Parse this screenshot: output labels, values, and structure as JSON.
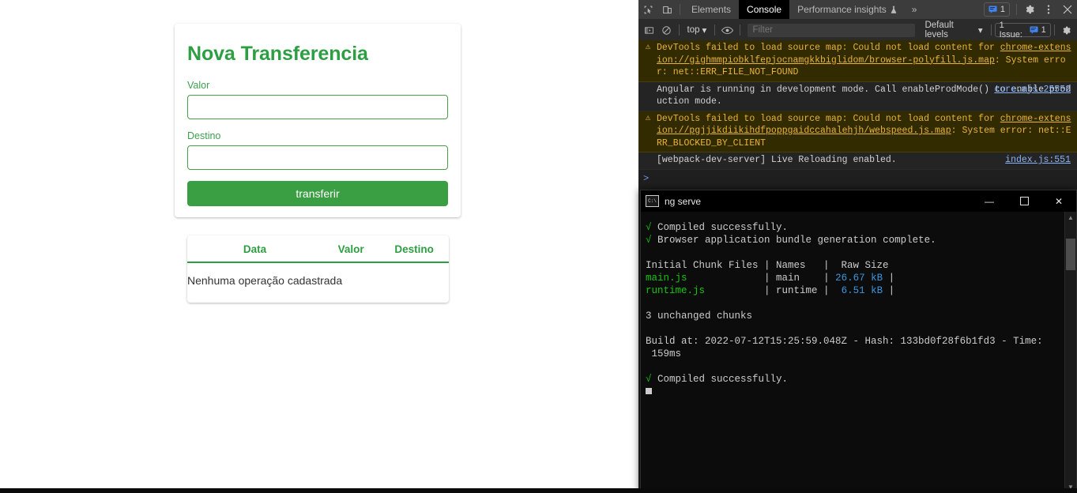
{
  "app": {
    "form": {
      "title": "Nova Transferencia",
      "fields": [
        {
          "label": "Valor",
          "value": "",
          "placeholder": ""
        },
        {
          "label": "Destino",
          "value": "",
          "placeholder": ""
        }
      ],
      "submit_label": "transferir",
      "accent_color": "#2e9e43",
      "button_color": "#3a9e43"
    },
    "table": {
      "headers": [
        "Data",
        "Valor",
        "Destino"
      ],
      "empty_message": "Nenhuma operação cadastrada"
    }
  },
  "devtools": {
    "toolbar": {
      "inspect_icon": "inspect-cursor-icon",
      "device_icon": "device-toolbar-icon",
      "tabs": [
        {
          "label": "Elements",
          "active": false
        },
        {
          "label": "Console",
          "active": true
        },
        {
          "label": "Performance insights",
          "active": false,
          "icon": "flask-icon"
        }
      ],
      "more_tabs": "»",
      "message_badge_count": "1",
      "settings_icon": "gear-icon",
      "menu_icon": "kebab-menu-icon",
      "close_icon": "close-icon"
    },
    "filterbar": {
      "sidebar_icon": "console-sidebar-icon",
      "clear_icon": "clear-console-icon",
      "context": "top",
      "eye_icon": "eye-icon",
      "filter_placeholder": "Filter",
      "filter_value": "",
      "levels": "Default levels",
      "issues_label": "1 Issue:",
      "issues_count": "1",
      "settings_icon": "gear-icon"
    },
    "messages": [
      {
        "level": "warn",
        "icon": "warning-icon",
        "text": "DevTools failed to load source map: Could not load content for chrome-extension://gighmmpiobklfepjocnamgkkbiglidom/browser-polyfill.js.map: System error: net::ERR_FILE_NOT_FOUND",
        "link_text": "chrome-extension://gighmmpiobklfepjocnamgkkbiglidom/browser-polyfill.js.map",
        "prefix": "DevTools failed to load source map: Could not load content for ",
        "suffix": ": System error: net::ERR_FILE_NOT_FOUND",
        "source": ""
      },
      {
        "level": "info",
        "icon": "",
        "prefix": "Angular is running in development mode. Call enableProdMode() to enable production mode.",
        "link_text": "",
        "suffix": "",
        "source": "core.mjs:25552"
      },
      {
        "level": "warn",
        "icon": "warning-icon",
        "prefix": "DevTools failed to load source map: Could not load content for ",
        "link_text": "chrome-extension://pgjjikdiikihdfpoppgaidccahalehjh/webspeed.js.map",
        "suffix": ": System error: net::ERR_BLOCKED_BY_CLIENT",
        "source": ""
      },
      {
        "level": "info",
        "icon": "",
        "prefix": "[webpack-dev-server] Live Reloading enabled.",
        "link_text": "",
        "suffix": "",
        "source": "index.js:551"
      }
    ],
    "prompt_symbol": ">",
    "prompt_value": ""
  },
  "terminal": {
    "title": "ng serve",
    "icon": "cmd-icon",
    "minimize_label": "—",
    "maximize_label": "☐",
    "close_label": "✕",
    "lines": [
      {
        "check": "√",
        "text": " Compiled successfully.",
        "color": "white"
      },
      {
        "check": "√",
        "text": " Browser application bundle generation complete.",
        "color": "white"
      },
      {
        "check": "",
        "text": "",
        "color": "white"
      },
      {
        "check": "",
        "text": "Initial Chunk Files | Names   |  Raw Size",
        "color": "white"
      },
      {
        "check": "",
        "text": "main.js             | main    | 26.67 kB |",
        "color": "cyan-row",
        "name": "main.js",
        "chunk": "main",
        "size": "26.67 kB"
      },
      {
        "check": "",
        "text": "runtime.js          | runtime |  6.51 kB |",
        "color": "cyan-row",
        "name": "runtime.js",
        "chunk": "runtime",
        "size": "6.51 kB"
      },
      {
        "check": "",
        "text": "",
        "color": "white"
      },
      {
        "check": "",
        "text": "3 unchanged chunks",
        "color": "white"
      },
      {
        "check": "",
        "text": "",
        "color": "white"
      },
      {
        "check": "",
        "text": "Build at: 2022-07-12T15:25:59.048Z - Hash: 133bd0f28f6b1fd3 - Time:",
        "color": "white"
      },
      {
        "check": "",
        "text": " 159ms",
        "color": "white"
      },
      {
        "check": "",
        "text": "",
        "color": "white"
      },
      {
        "check": "√",
        "text": " Compiled successfully.",
        "color": "white"
      }
    ],
    "build_at": "2022-07-12T15:25:59.048Z",
    "hash": "133bd0f28f6b1fd3",
    "time": "159ms",
    "unchanged_chunks": "3 unchanged chunks"
  }
}
